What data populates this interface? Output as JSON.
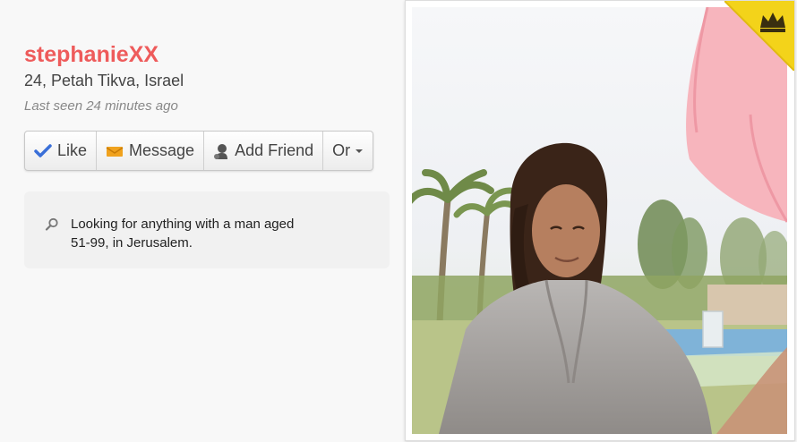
{
  "profile": {
    "username": "stephanieXX",
    "location": "24, Petah Tikva, Israel",
    "last_seen": "Last seen 24 minutes ago"
  },
  "actions": {
    "like": "Like",
    "message": "Message",
    "add_friend": "Add Friend",
    "more": "Or"
  },
  "looking_for": {
    "text": "Looking for anything with a man aged 51-99, in Jerusalem."
  },
  "colors": {
    "username": "#ee5b5b",
    "like_check": "#3a6fd8",
    "message_envelope": "#f0a21e",
    "crown_badge": "#f3d31a"
  },
  "icons": {
    "like": "checkmark-icon",
    "message": "envelope-icon",
    "add_friend": "person-icon",
    "more": "caret-down-icon",
    "search": "magnifier-icon",
    "badge": "crown-icon"
  }
}
